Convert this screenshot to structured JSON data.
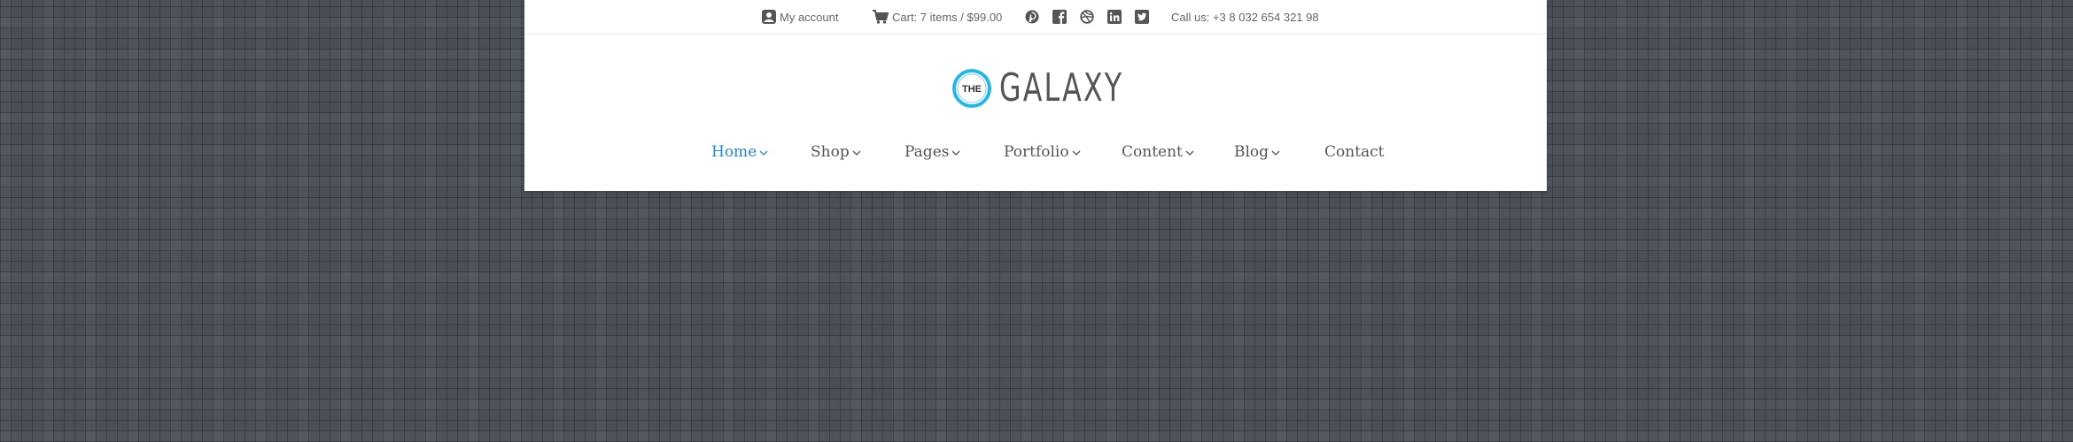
{
  "topbar": {
    "account_label": "My account",
    "cart_label": "Cart: 7 items / $99.00",
    "phone_label": "Call us: +3 8 032 654 321 98",
    "social_icons": [
      "pinterest-icon",
      "facebook-icon",
      "dribbble-icon",
      "linkedin-icon",
      "twitter-icon"
    ]
  },
  "logo": {
    "badge_text": "THE",
    "name": "GALAXY",
    "accent_color": "#29b6e6"
  },
  "nav": {
    "items": [
      {
        "label": "Home",
        "has_dropdown": true,
        "active": true
      },
      {
        "label": "Shop",
        "has_dropdown": true
      },
      {
        "label": "Pages",
        "has_dropdown": true
      },
      {
        "label": "Portfolio",
        "has_dropdown": true
      },
      {
        "label": "Content",
        "has_dropdown": true
      },
      {
        "label": "Blog",
        "has_dropdown": true
      },
      {
        "label": "Contact",
        "has_dropdown": false
      }
    ],
    "active_color": "#2e84c6",
    "text_color": "#555555"
  },
  "colors": {
    "page_background": "#494e57",
    "header_background": "#ffffff"
  }
}
